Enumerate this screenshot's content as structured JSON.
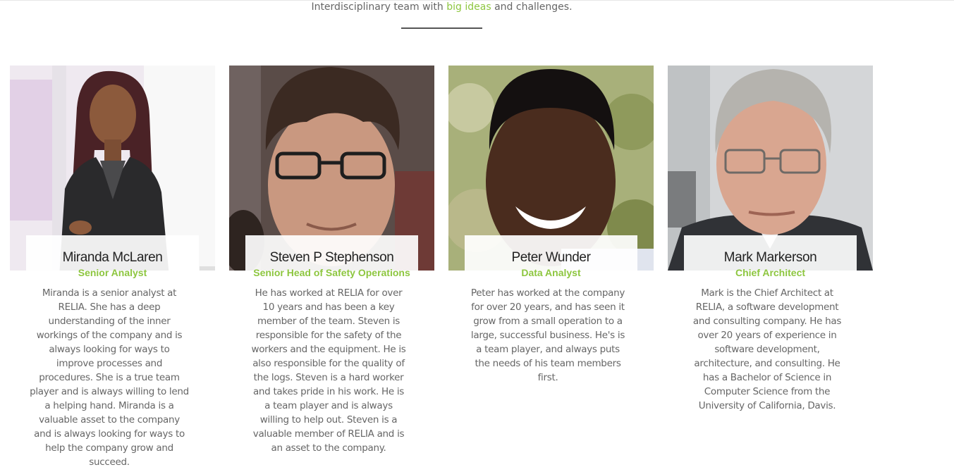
{
  "intro": {
    "prefix": "Interdisciplinary team with ",
    "highlight": "big ideas",
    "suffix": " and challenges."
  },
  "colors": {
    "accent": "#8dc63f",
    "text": "#666666",
    "name": "#222222"
  },
  "team": [
    {
      "name": "Miranda McLaren",
      "role": "Senior Analyst",
      "bio": "Miranda is a senior analyst at RELIA. She has a deep understanding of the inner workings of the company and is always looking for ways to improve processes and procedures. She is a true team player and is always willing to lend a helping hand. Miranda is a valuable asset to the company and is always looking for ways to help the company grow and succeed."
    },
    {
      "name": "Steven P Stephenson",
      "role": "Senior Head of Safety Operations",
      "bio": "He has worked at RELIA for over 10 years and has been a key member of the team. Steven is responsible for the safety of the workers and the equipment. He is also responsible for the quality of the logs. Steven is a hard worker and takes pride in his work. He is a team player and is always willing to help out. Steven is a valuable member of RELIA and is an asset to the company."
    },
    {
      "name": "Peter Wunder",
      "role": "Data Analyst",
      "bio": "Peter has worked at the company for over 20 years, and has seen it grow from a small operation to a large, successful business. He's is a team player, and always puts the needs of his team members first."
    },
    {
      "name": "Mark Markerson",
      "role": "Chief Architect",
      "bio": "Mark is the Chief Architect at RELIA, a software development and consulting company. He has over 20 years of experience in software development, architecture, and consulting. He has a Bachelor of Science in Computer Science from the University of California, Davis."
    }
  ]
}
